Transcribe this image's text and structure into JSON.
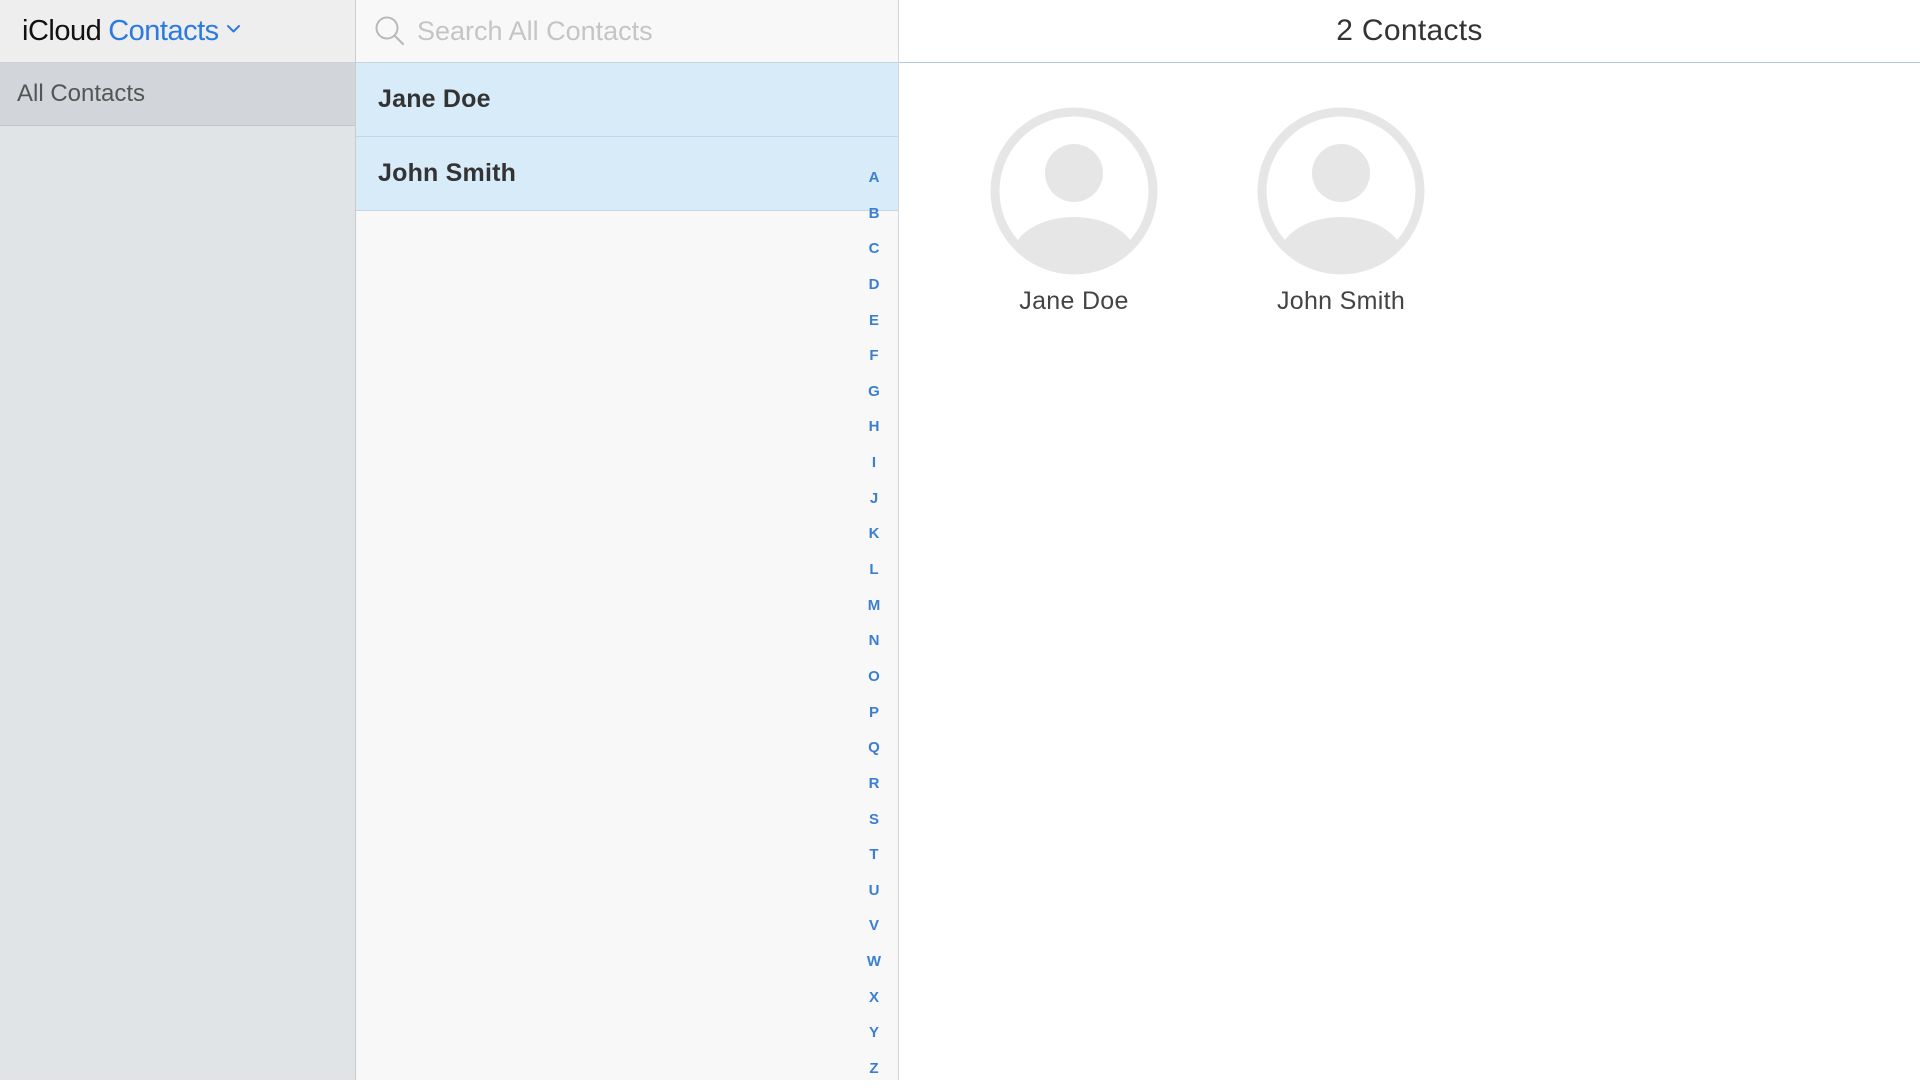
{
  "sidebar": {
    "brand": {
      "icloud": "iCloud",
      "app": "Contacts"
    },
    "groups": [
      {
        "label": "All Contacts"
      }
    ]
  },
  "contact_list": {
    "search": {
      "placeholder": "Search All Contacts",
      "value": ""
    },
    "rows": [
      {
        "name": "Jane Doe"
      },
      {
        "name": "John Smith"
      }
    ],
    "alpha_index": [
      "A",
      "B",
      "C",
      "D",
      "E",
      "F",
      "G",
      "H",
      "I",
      "J",
      "K",
      "L",
      "M",
      "N",
      "O",
      "P",
      "Q",
      "R",
      "S",
      "T",
      "U",
      "V",
      "W",
      "X",
      "Y",
      "Z"
    ]
  },
  "detail": {
    "count_label": "2 Contacts",
    "cards": [
      {
        "name": "Jane Doe",
        "icon": "person-silhouette-icon"
      },
      {
        "name": "John Smith",
        "icon": "person-silhouette-icon"
      }
    ]
  },
  "colors": {
    "accent": "#2a7ae2",
    "selected_row": "#d8ebf9",
    "sidebar_bg": "#e1e4e7",
    "index_letter": "#3b7fd0"
  }
}
